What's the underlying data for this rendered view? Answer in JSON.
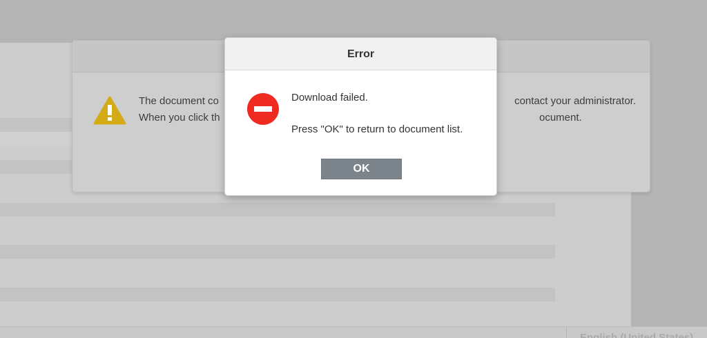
{
  "warning_dialog": {
    "line1_left": "The document co",
    "line1_right": "contact your administrator.",
    "line2_left": "When you click th",
    "line2_right": "ocument.",
    "icon": "warning-triangle-icon",
    "icon_color": "#d4aa16"
  },
  "error_dialog": {
    "title": "Error",
    "message": "Download failed.",
    "instruction": "Press \"OK\" to return to document list.",
    "ok_label": "OK",
    "icon": "stop-icon",
    "icon_color": "#ef2a21"
  },
  "status_bar": {
    "language": "English (United States)"
  }
}
